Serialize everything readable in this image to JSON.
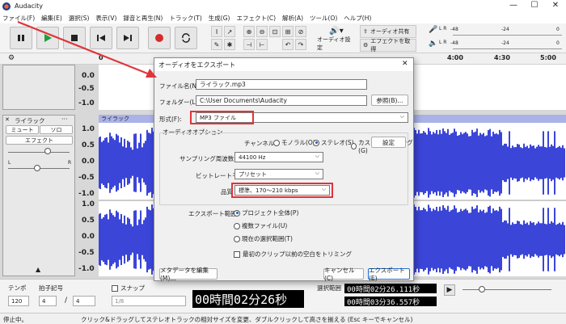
{
  "window": {
    "title": "Audacity",
    "min": "—",
    "max": "☐",
    "close": "✕"
  },
  "menu": [
    "ファイル(F)",
    "編集(E)",
    "選択(S)",
    "表示(V)",
    "録音と再生(N)",
    "トラック(T)",
    "生成(G)",
    "エフェクト(C)",
    "解析(A)",
    "ツール(O)",
    "ヘルプ(H)"
  ],
  "toolbar": {
    "audio_setup": "オーディオ設定",
    "share_audio": "オーディオ共有",
    "get_effects": "エフェクトを取得",
    "meter_ticks_top": [
      "-48",
      "-24",
      "0"
    ],
    "meter_ticks_bottom": [
      "-48",
      "-24",
      "0"
    ],
    "meter_lr_top": "L R",
    "meter_lr_bottom": "L R"
  },
  "ruler": {
    "ticks": [
      "0",
      "4:00",
      "4:30",
      "5:00"
    ]
  },
  "tracks": {
    "scale_top": [
      "0.0",
      "-0.5",
      "-1.0"
    ],
    "track_name": "ライラック",
    "clip_name": "ライラック",
    "mute": "ミュート",
    "solo": "ソロ",
    "effects": "エフェクト",
    "left": "L",
    "right": "R",
    "scale_ch1": [
      "1.0",
      "0.5",
      "0.0",
      "-0.5",
      "-1.0"
    ],
    "scale_ch2": [
      "1.0",
      "0.5",
      "0.0",
      "-0.5",
      "-1.0"
    ],
    "collapse": "▲",
    "menu_dots": "···",
    "close_x": "✕"
  },
  "dialog": {
    "title": "オーディオをエクスポート",
    "close": "✕",
    "filename_label": "ファイル名(N):",
    "filename_value": "ライラック.mp3",
    "folder_label": "フォルダー(L):",
    "folder_value": "C:\\User          Documents\\Audacity",
    "browse": "参照(B)...",
    "format_label": "形式(F):",
    "format_value": "MP3 ファイル",
    "audio_options": "オーディオオプション",
    "channel_label": "チャンネル",
    "mono": "モノラル(O)",
    "stereo": "ステレオ(S)",
    "custom": "カスタムマッピング(G)",
    "settings": "設定",
    "samplerate_label": "サンプリング周波数(R)",
    "samplerate_value": "44100 Hz",
    "bitrate_label": "ビットレートモード",
    "bitrate_value": "プリセット",
    "quality_label": "品質",
    "quality_value": "標準、170〜210 kbps",
    "range_label": "エクスポート範囲:",
    "range_project": "プロジェクト全体(P)",
    "range_multi": "複数ファイル(U)",
    "range_selection": "現在の選択範囲(T)",
    "trim": "最初のクリップ以前の空白をトリミング",
    "edit_meta": "メタデータを編集(M)...",
    "cancel": "キャンセル(C)",
    "export": "エクスポート(E)",
    "dd_arrow": "⌵"
  },
  "bottom": {
    "tempo_label": "テンポ",
    "tempo_value": "120",
    "timesig_label": "拍子記号",
    "timesig_num": "4",
    "timesig_sep": "/",
    "timesig_den": "4",
    "snap_label": "スナップ",
    "snap_value": "1/8",
    "time_main": "00時間02分26秒",
    "sel_label": "選択範囲",
    "sel_start": "00時間02分26.111秒",
    "sel_end": "00時間03分36.557秒",
    "play": "▶"
  },
  "status": {
    "left": "停止中。",
    "message": "クリック&ドラッグしてステレオトラックの相対サイズを変更、ダブルクリックして高さを揃える (Esc キーでキャンセル)"
  },
  "colors": {
    "wave": "#3b45d8",
    "highlight": "#e0343a",
    "arrow": "#e0343a"
  }
}
